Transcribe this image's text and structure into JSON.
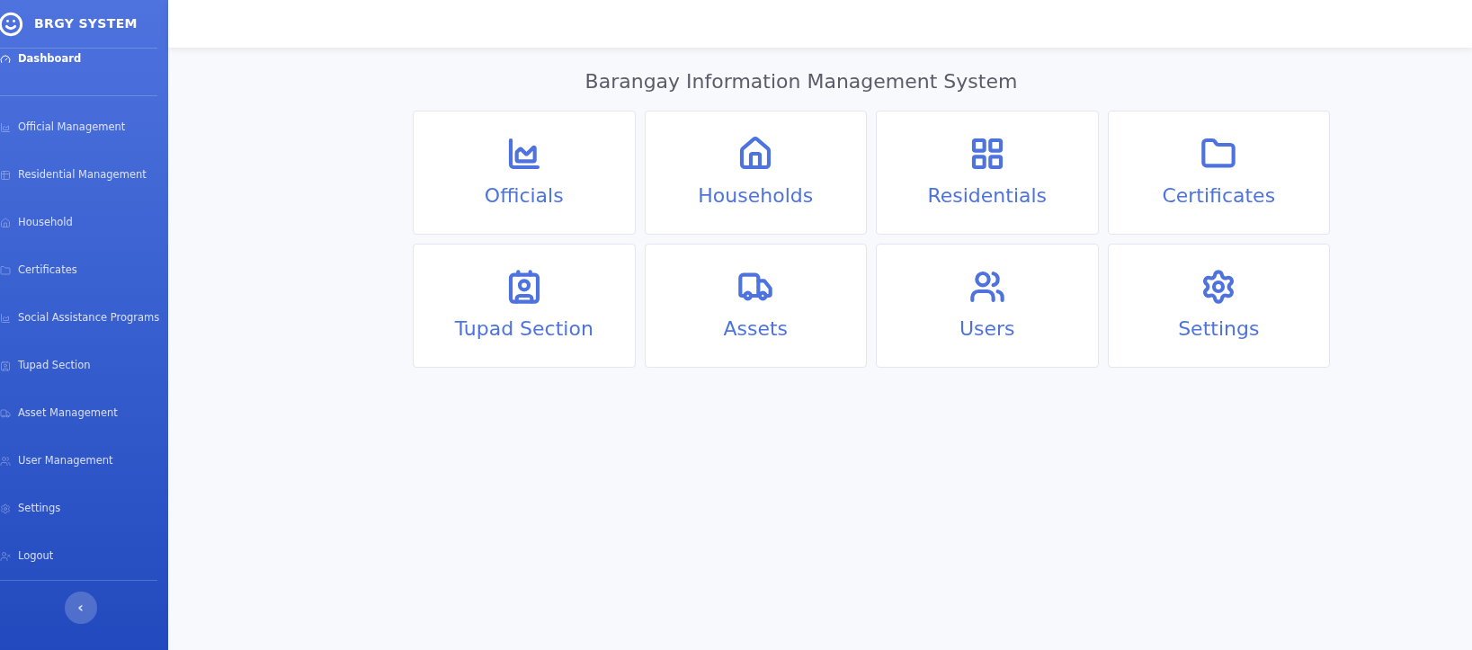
{
  "sidebar": {
    "brand": "BRGY SYSTEM",
    "items": [
      {
        "label": "Dashboard",
        "selected": true
      },
      {
        "label": "Official Management",
        "selected": false
      },
      {
        "label": "Residential Management",
        "selected": false
      },
      {
        "label": "Household",
        "selected": false
      },
      {
        "label": "Certificates",
        "selected": false
      },
      {
        "label": "Social Assistance Programs",
        "selected": false
      },
      {
        "label": "Tupad Section",
        "selected": false
      },
      {
        "label": "Asset Management",
        "selected": false
      },
      {
        "label": "User Management",
        "selected": false
      },
      {
        "label": "Settings",
        "selected": false
      },
      {
        "label": "Logout",
        "selected": false
      }
    ],
    "toggle": "‹"
  },
  "page_title": "Barangay Information Management System",
  "cards": [
    {
      "label": "Officials"
    },
    {
      "label": "Households"
    },
    {
      "label": "Residentials"
    },
    {
      "label": "Certificates"
    },
    {
      "label": "Tupad Section"
    },
    {
      "label": "Assets"
    },
    {
      "label": "Users"
    },
    {
      "label": "Settings"
    }
  ]
}
